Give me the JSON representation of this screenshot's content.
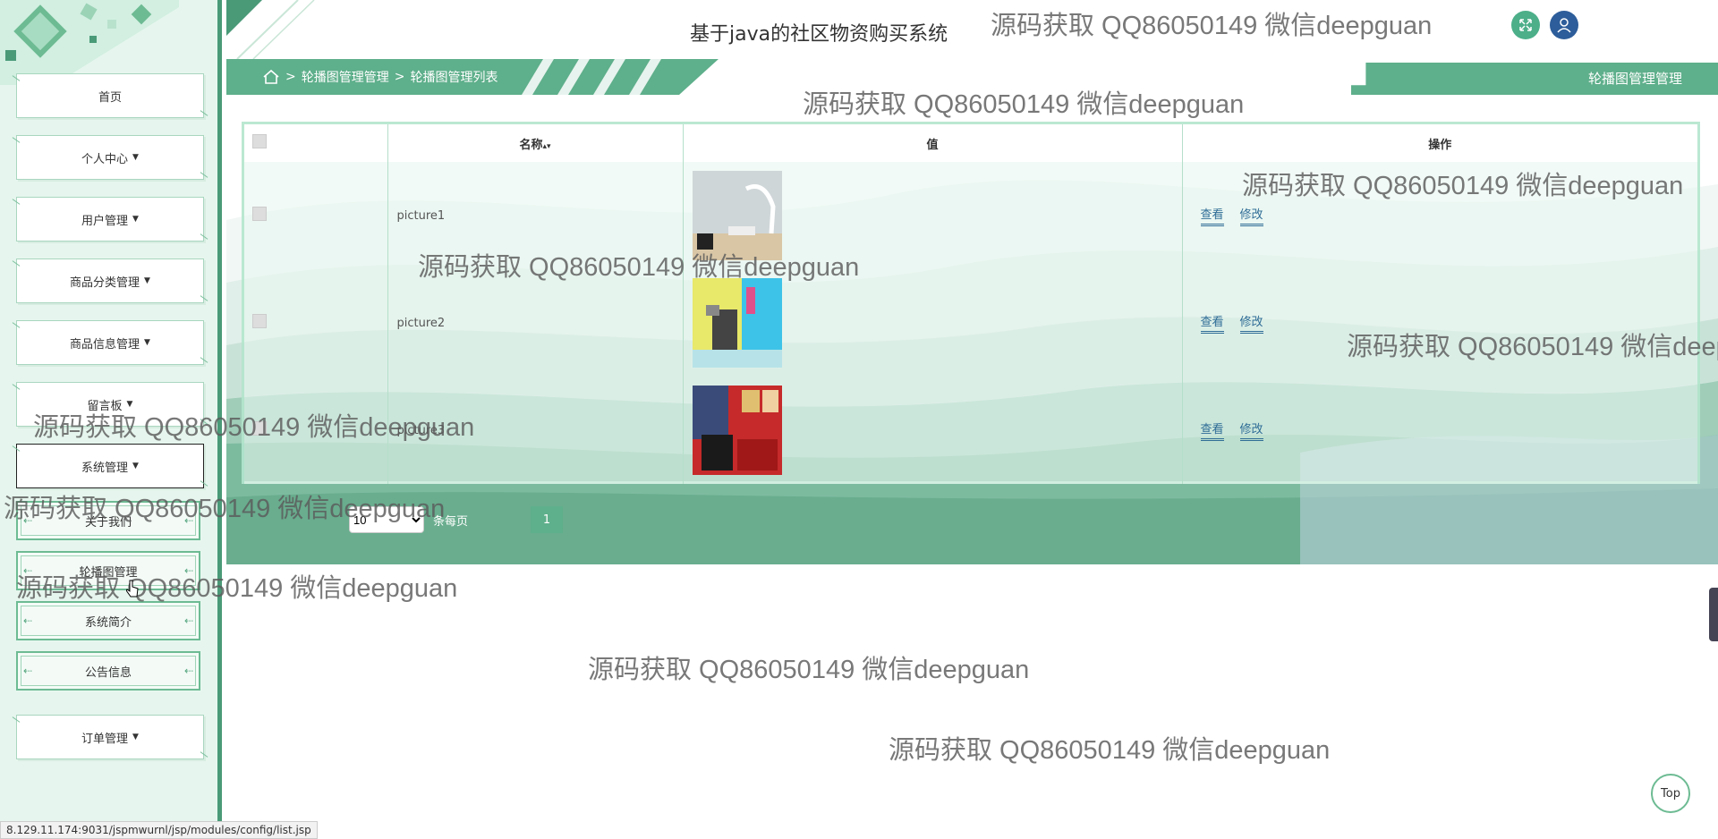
{
  "header": {
    "title": "基于java的社区物资购买系统",
    "fullscreen_icon": "expand-icon",
    "user_icon": "user-icon",
    "accent": "#4a9a78"
  },
  "breadcrumb": {
    "items": [
      "轮播图管理管理",
      "轮播图管理列表"
    ],
    "separator": ">"
  },
  "tab_label": "轮播图管理管理",
  "sidebar": {
    "items": [
      {
        "label": "首页",
        "has_caret": false
      },
      {
        "label": "个人中心",
        "has_caret": true
      },
      {
        "label": "用户管理",
        "has_caret": true
      },
      {
        "label": "商品分类管理",
        "has_caret": true
      },
      {
        "label": "商品信息管理",
        "has_caret": true
      },
      {
        "label": "留言板",
        "has_caret": true
      },
      {
        "label": "系统管理",
        "has_caret": true
      },
      {
        "label": "订单管理",
        "has_caret": true
      }
    ],
    "sub_items": [
      "关于我们",
      "轮播图管理",
      "系统简介",
      "公告信息"
    ]
  },
  "table": {
    "columns": [
      "",
      "名称",
      "值",
      "操作"
    ],
    "sort_icon": "sort-icon",
    "rows": [
      {
        "name": "picture1",
        "view": "查看",
        "edit": "修改"
      },
      {
        "name": "picture2",
        "view": "查看",
        "edit": "修改"
      },
      {
        "name": "picture3",
        "view": "查看",
        "edit": "修改"
      }
    ]
  },
  "pager": {
    "page_size": "10",
    "page_size_options": [
      "10"
    ],
    "per_page_label": "条每页",
    "current_page": "1"
  },
  "watermark_text": "源码获取 QQ86050149 微信deepguan",
  "top_button": "Top",
  "status_url": "8.129.11.174:9031/jspmwurnl/jsp/modules/config/list.jsp"
}
